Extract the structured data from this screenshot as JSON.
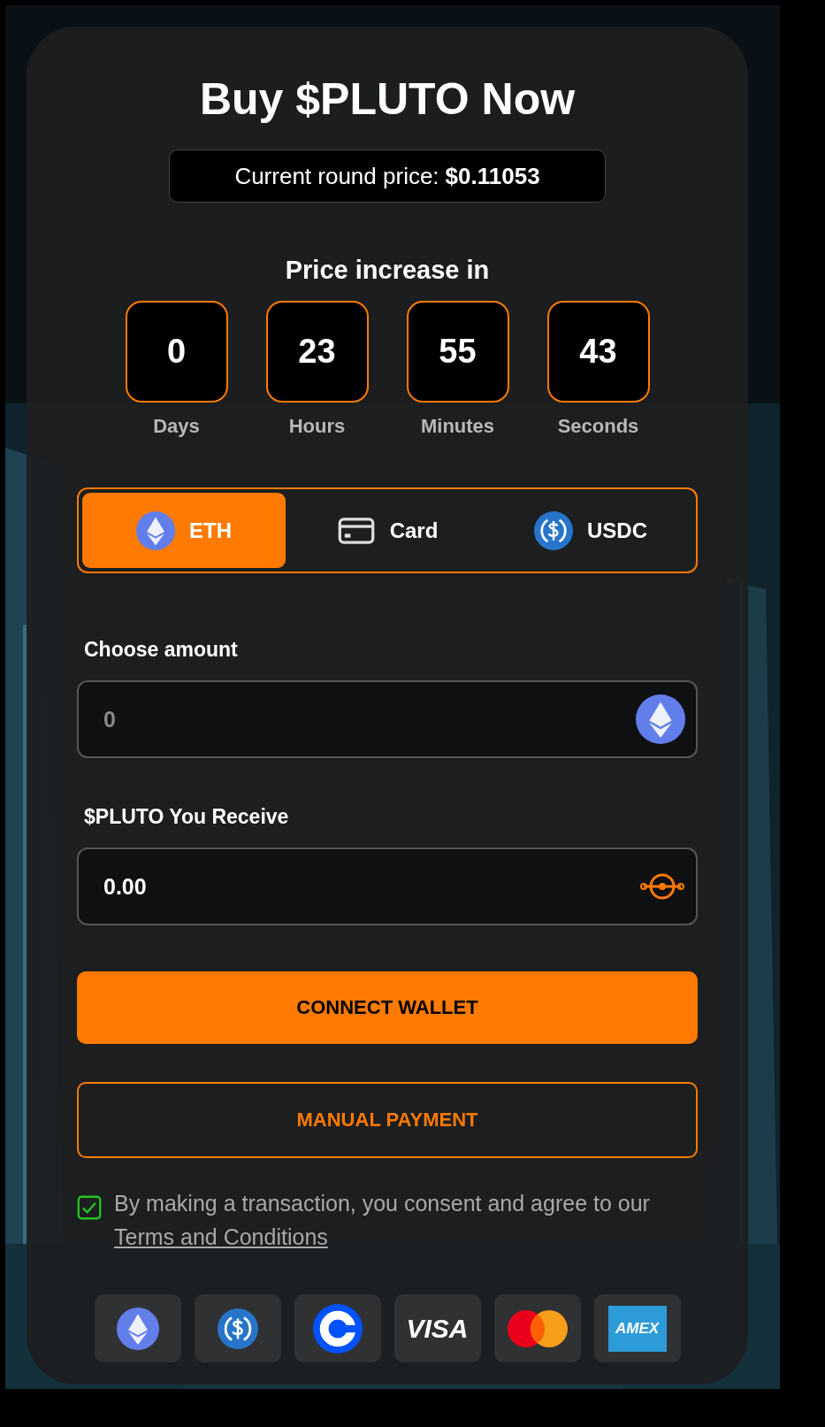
{
  "title": "Buy $PLUTO Now",
  "price": {
    "label": "Current round price:",
    "value": "$0.11053"
  },
  "countdown": {
    "title": "Price increase in",
    "units": [
      {
        "value": "0",
        "label": "Days"
      },
      {
        "value": "23",
        "label": "Hours"
      },
      {
        "value": "55",
        "label": "Minutes"
      },
      {
        "value": "43",
        "label": "Seconds"
      }
    ]
  },
  "tabs": [
    {
      "label": "ETH",
      "kind": "eth",
      "selected": true
    },
    {
      "label": "Card",
      "kind": "card",
      "selected": false
    },
    {
      "label": "USDC",
      "kind": "usdc",
      "selected": false
    }
  ],
  "fields": [
    {
      "label": "Choose amount",
      "placeholder": "0",
      "kind": "eth"
    },
    {
      "label": "$PLUTO You Receive",
      "value": "0.00",
      "kind": "pluto"
    }
  ],
  "buttons": [
    {
      "label": "CONNECT WALLET",
      "kind": "primary"
    },
    {
      "label": "MANUAL PAYMENT",
      "kind": "outline"
    }
  ],
  "consent": {
    "checked": true,
    "text": "By making a transaction, you consent and agree to our",
    "link": "Terms and Conditions"
  },
  "payment_methods": [
    {
      "kind": "eth"
    },
    {
      "kind": "usdc"
    },
    {
      "kind": "coinbase"
    },
    {
      "kind": "visa",
      "label": "VISA"
    },
    {
      "kind": "mastercard"
    },
    {
      "kind": "amex",
      "label": "AMEX"
    }
  ]
}
